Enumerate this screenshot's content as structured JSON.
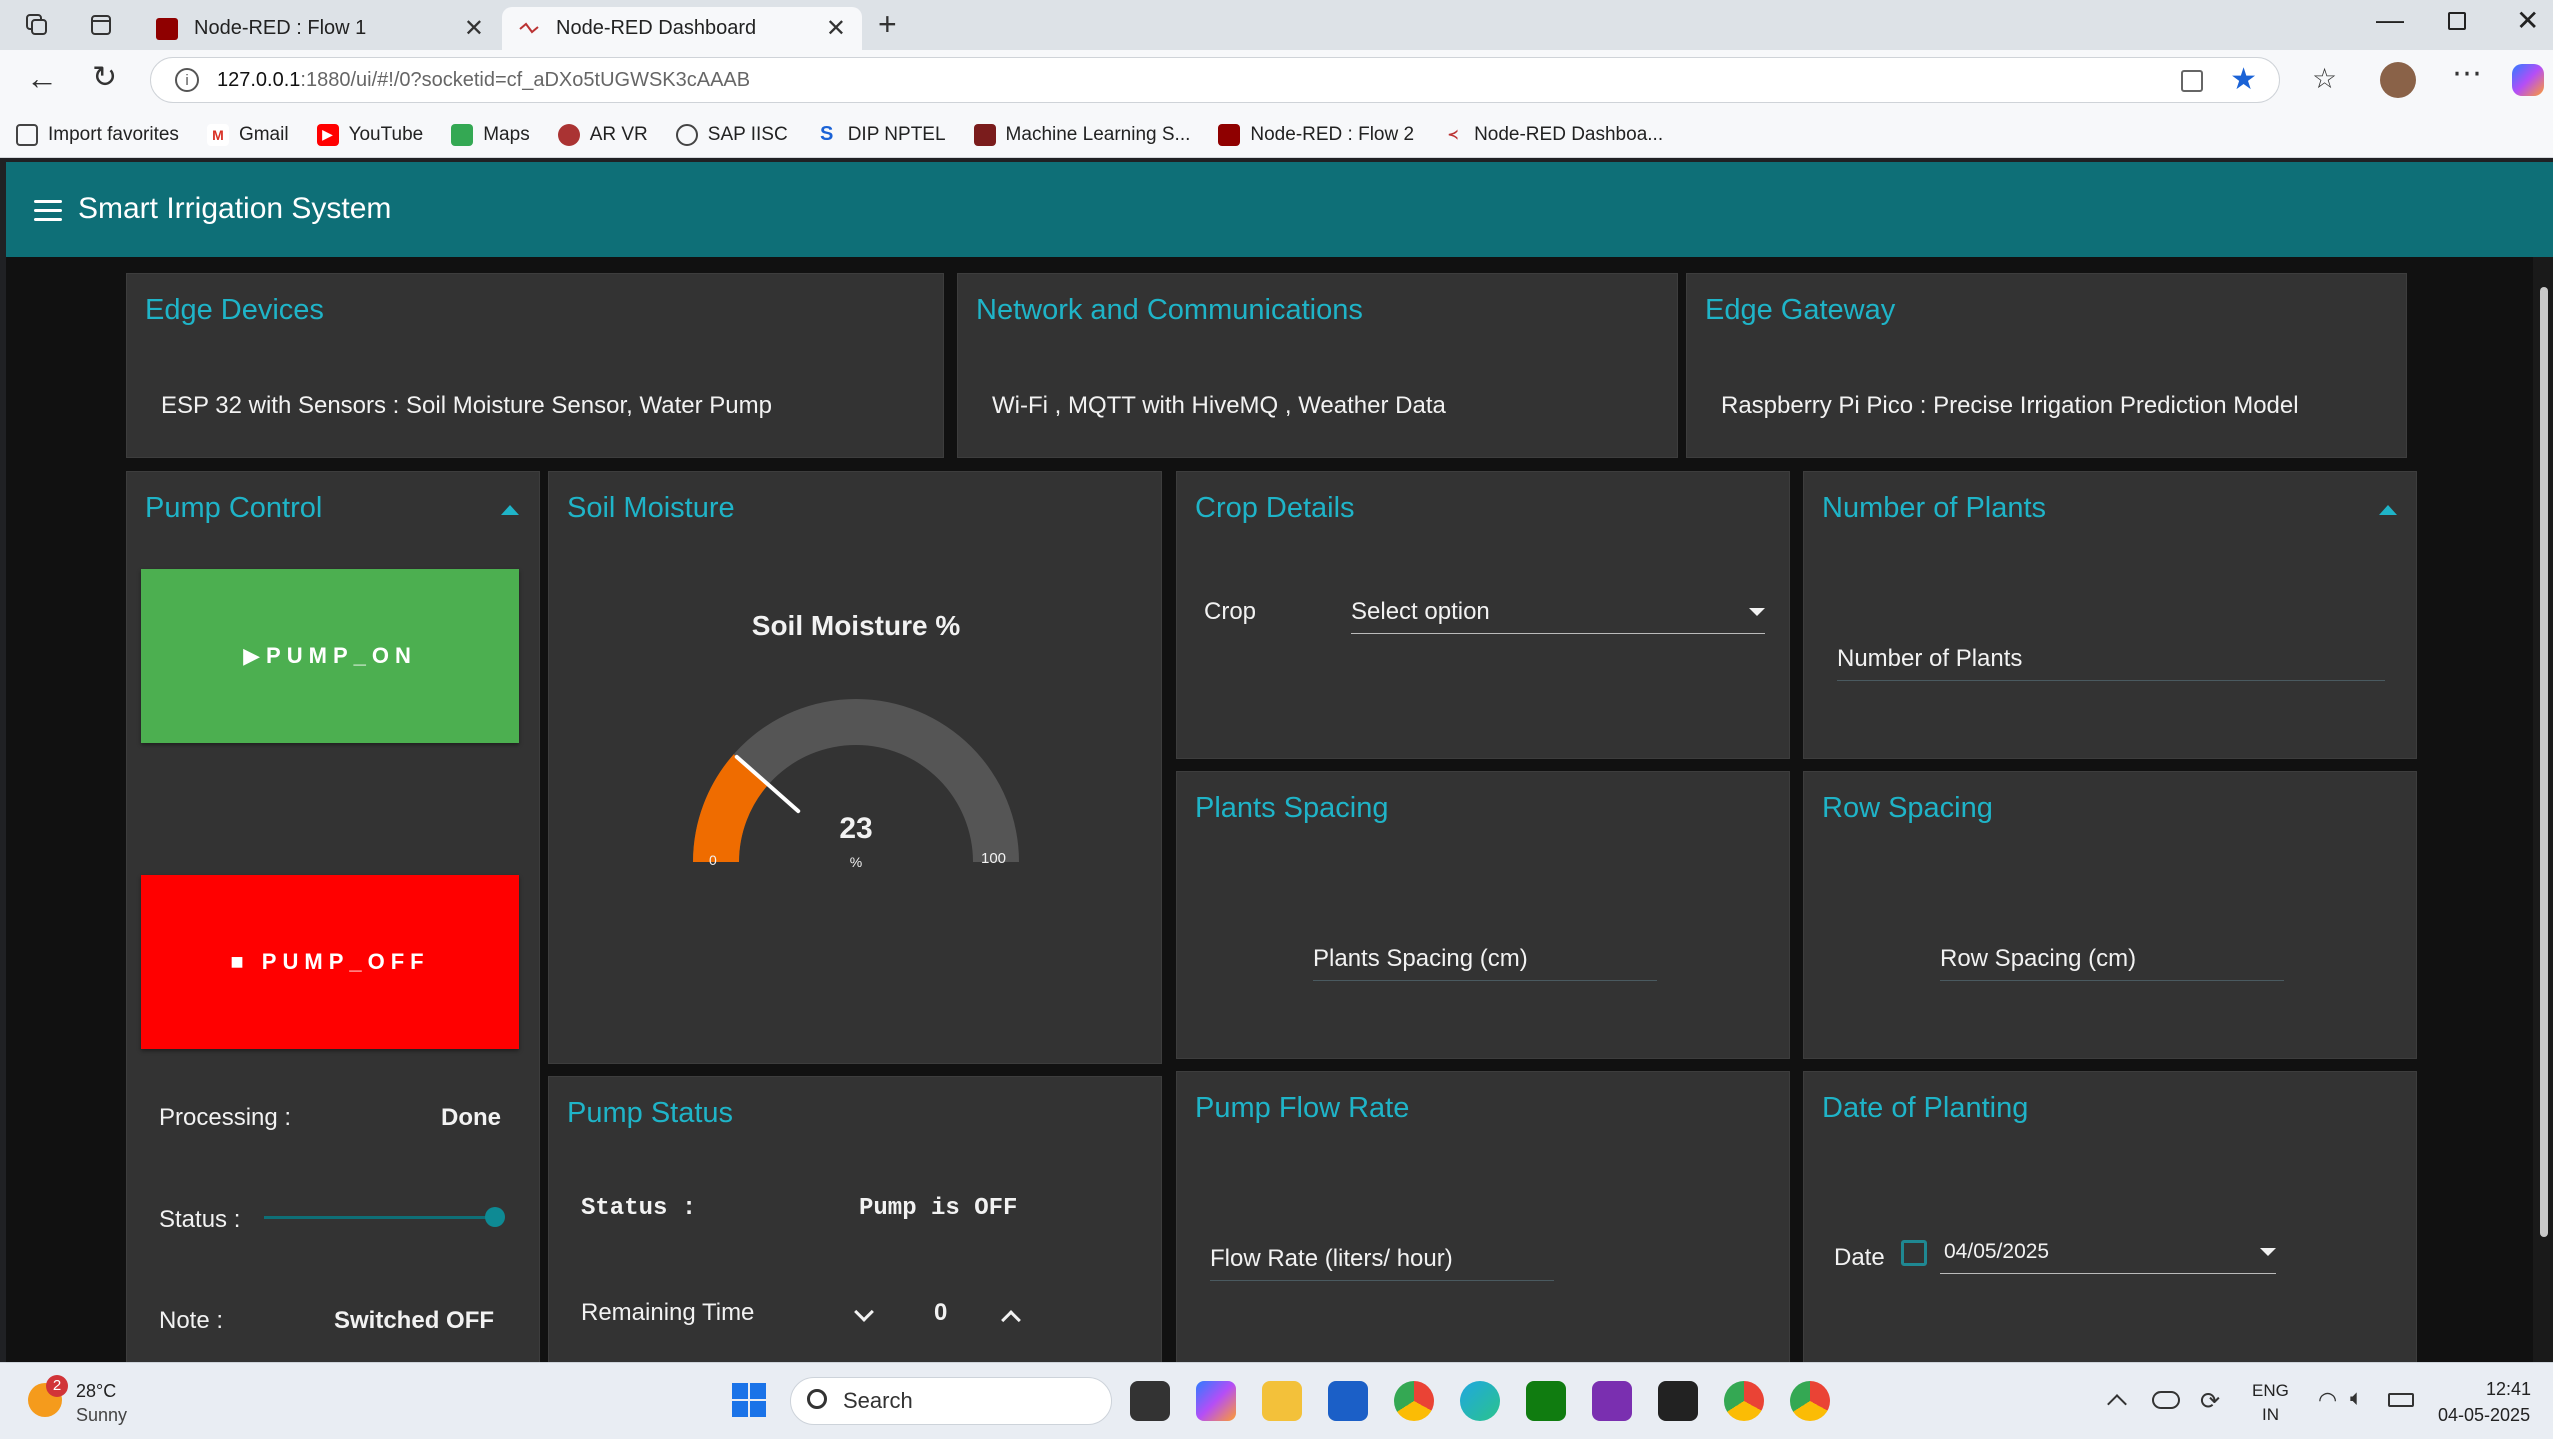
{
  "browser": {
    "tabs": [
      {
        "title": "Node-RED : Flow 1",
        "active": false
      },
      {
        "title": "Node-RED Dashboard",
        "active": true
      }
    ],
    "url_host": "127.0.0.1",
    "url_rest": ":1880/ui/#!/0?socketid=cf_aDXo5tUGWSK3cAAAB",
    "bookmarks": [
      "Import favorites",
      "Gmail",
      "YouTube",
      "Maps",
      "AR VR",
      "SAP IISC",
      "DIP NPTEL",
      "Machine Learning S...",
      "Node-RED : Flow 2",
      "Node-RED Dashboa..."
    ]
  },
  "app": {
    "title": "Smart Irrigation System",
    "accent": "#1fb4c8",
    "header_color": "#0e6f77"
  },
  "cards": {
    "edge_devices": {
      "title": "Edge Devices",
      "text": "ESP 32 with Sensors : Soil Moisture Sensor, Water Pump"
    },
    "network": {
      "title": "Network and Communications",
      "text": "Wi-Fi , MQTT with HiveMQ , Weather Data"
    },
    "gateway": {
      "title": "Edge Gateway",
      "text": "Raspberry Pi Pico : Precise Irrigation Prediction Model"
    },
    "pump_control": {
      "title": "Pump Control",
      "on_label": "▶PUMP_ON",
      "off_label": "■ PUMP_OFF",
      "processing_label": "Processing :",
      "processing_value": "Done",
      "status_label": "Status :",
      "status_value": 1.0,
      "note_label": "Note :",
      "note_value": "Switched OFF",
      "on_color": "#4caf50",
      "off_color": "#ff0000"
    },
    "soil_moisture": {
      "title": "Soil Moisture",
      "gauge_title": "Soil Moisture %",
      "value": 23,
      "min": 0,
      "max": 100,
      "unit": "%",
      "gauge_color": "#ef6c00"
    },
    "pump_status": {
      "title": "Pump Status",
      "status_label": "Status :",
      "status_value": "Pump is OFF",
      "remaining_label": "Remaining Time",
      "remaining_value": "0"
    },
    "crop_details": {
      "title": "Crop Details",
      "label": "Crop",
      "select_value": "Select option"
    },
    "num_plants": {
      "title": "Number of Plants",
      "placeholder": "Number of Plants"
    },
    "plants_spacing": {
      "title": "Plants Spacing",
      "placeholder": "Plants Spacing (cm)"
    },
    "row_spacing": {
      "title": "Row Spacing",
      "placeholder": "Row Spacing (cm)"
    },
    "flow_rate": {
      "title": "Pump Flow Rate",
      "placeholder": "Flow Rate (liters/ hour)"
    },
    "planting_date": {
      "title": "Date of Planting",
      "label": "Date",
      "value": "04/05/2025"
    }
  },
  "taskbar": {
    "weather_temp": "28°C",
    "weather_desc": "Sunny",
    "weather_badge": "2",
    "search_placeholder": "Search",
    "lang_top": "ENG",
    "lang_bottom": "IN",
    "time": "12:41",
    "date": "04-05-2025"
  }
}
